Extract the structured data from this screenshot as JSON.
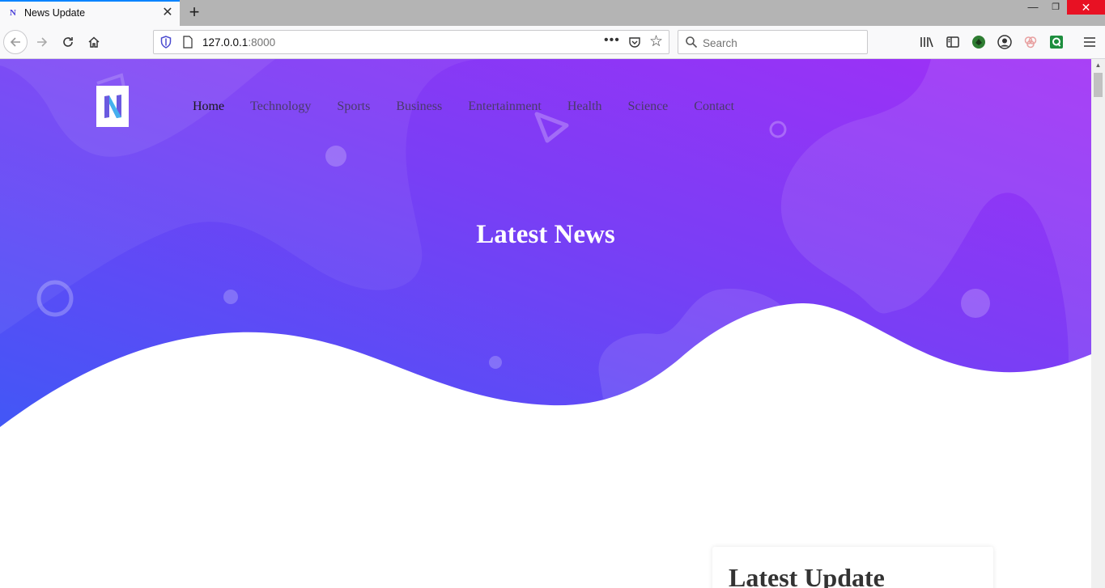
{
  "browser": {
    "tab_title": "News Update",
    "favicon_letter": "N",
    "close_glyph": "✕",
    "new_tab_glyph": "+",
    "url_host": "127.0.0.1",
    "url_port": ":8000",
    "search_placeholder": "Search",
    "window_controls": {
      "minimize": "—",
      "maximize": "❐",
      "close": "✕"
    }
  },
  "site": {
    "logo_letter": "N",
    "nav": [
      {
        "label": "Home",
        "active": true
      },
      {
        "label": "Technology",
        "active": false
      },
      {
        "label": "Sports",
        "active": false
      },
      {
        "label": "Business",
        "active": false
      },
      {
        "label": "Entertainment",
        "active": false
      },
      {
        "label": "Health",
        "active": false
      },
      {
        "label": "Science",
        "active": false
      },
      {
        "label": "Contact",
        "active": false
      }
    ],
    "hero_title": "Latest News",
    "sidebar_title": "Latest Update"
  },
  "colors": {
    "hero_gradient_start": "#4a55f5",
    "hero_gradient_end": "#a12ff5",
    "accent_tab": "#0a84ff",
    "close_red": "#e81123"
  },
  "icons": [
    "shield-icon",
    "page-icon",
    "pocket-icon",
    "star-icon",
    "search-icon",
    "library-icon",
    "sidebar-icon",
    "extension-icon",
    "account-icon",
    "menu-icon"
  ]
}
